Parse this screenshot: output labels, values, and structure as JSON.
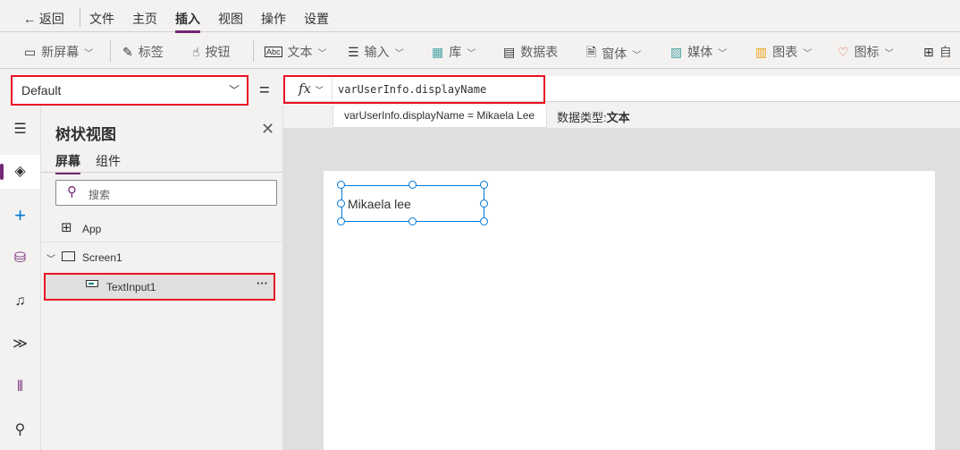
{
  "menu": {
    "back": "返回",
    "items": [
      "文件",
      "主页",
      "插入",
      "视图",
      "操作",
      "设置"
    ],
    "active": "插入"
  },
  "toolbar": {
    "items": [
      "新屏幕",
      "标签",
      "按钮",
      "文本",
      "输入",
      "库",
      "数据表",
      "窗体",
      "媒体",
      "图表",
      "图标",
      "自"
    ]
  },
  "property": {
    "selected": "Default"
  },
  "formula": {
    "equals": "=",
    "fx": "fx",
    "value": "varUserInfo.displayName",
    "hint": "varUserInfo.displayName  =  Mikaela Lee",
    "datatype_label": "数据类型:",
    "datatype_value": "文本"
  },
  "tree": {
    "title": "树状视图",
    "tabs": [
      "屏幕",
      "组件"
    ],
    "search_placeholder": "搜索",
    "items": [
      "App",
      "Screen1",
      "TextInput1"
    ],
    "more": "···"
  },
  "canvas": {
    "textinput_value": "Mikaela lee"
  },
  "colors": {
    "accent": "#742774",
    "highlight": "#e81123",
    "selection": "#0078d4"
  }
}
